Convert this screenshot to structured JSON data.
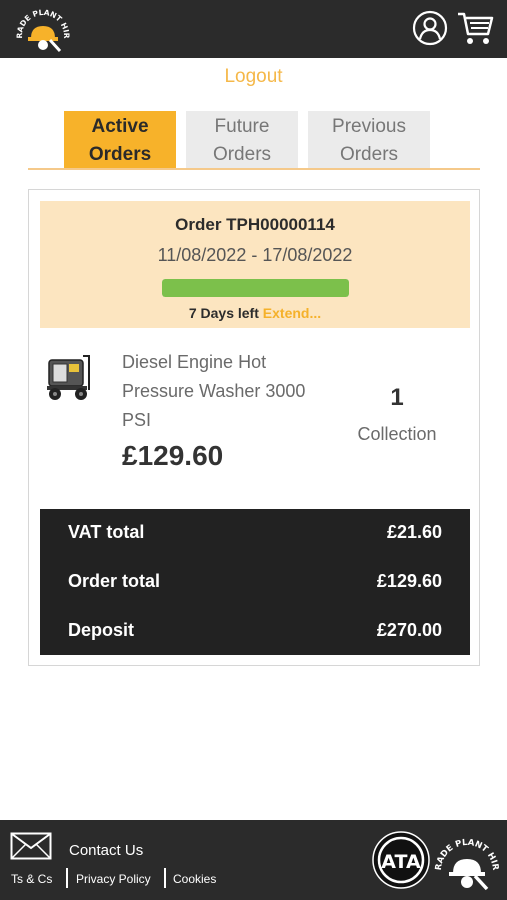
{
  "header": {
    "brand_text": "TRADE PLANT HIRE",
    "user_icon": "user-account-icon",
    "cart_icon": "shopping-cart-icon"
  },
  "logout_label": "Logout",
  "tabs": [
    {
      "line1": "Active",
      "line2": "Orders",
      "active": true
    },
    {
      "line1": "Future",
      "line2": "Orders",
      "active": false
    },
    {
      "line1": "Previous",
      "line2": "Orders",
      "active": false
    }
  ],
  "order": {
    "title": "Order TPH00000114",
    "dates": "11/08/2022 - 17/08/2022",
    "progress": 1.0,
    "days_left": "7 Days left",
    "extend_label": "Extend..."
  },
  "item": {
    "name": "Diesel Engine Hot Pressure Washer 3000 PSI",
    "price": "£129.60",
    "quantity": "1",
    "method": "Collection"
  },
  "totals": {
    "vat_label": "VAT total",
    "vat_value": "£21.60",
    "order_label": "Order total",
    "order_value": "£129.60",
    "deposit_label": "Deposit",
    "deposit_value": "£270.00"
  },
  "footer": {
    "contact_label": "Contact Us",
    "terms_label": "Ts & Cs",
    "privacy_label": "Privacy Policy",
    "cookies_label": "Cookies",
    "badge_text": "ATA",
    "brand_text": "TRADE PLANT HIRE"
  },
  "colors": {
    "accent": "#f7b22a",
    "header_bg": "#2b2b2b",
    "progress": "#7cc04b",
    "order_box_bg": "#fce5c0"
  }
}
